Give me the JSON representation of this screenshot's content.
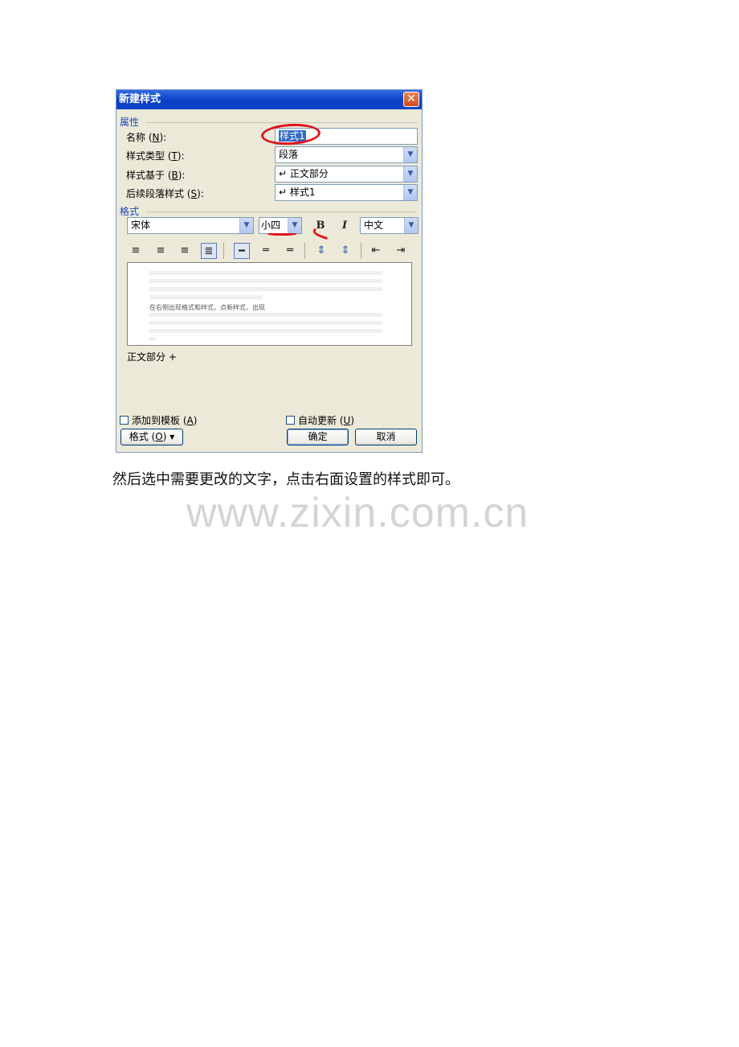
{
  "dialog": {
    "title": "新建样式",
    "close_glyph": "✕",
    "sections": {
      "properties": "属性",
      "format": "格式"
    },
    "fields": {
      "name": {
        "label": "名称",
        "key": "N",
        "value": "样式1"
      },
      "style_type": {
        "label": "样式类型",
        "key": "T",
        "value": "段落"
      },
      "based_on": {
        "label": "样式基于",
        "key": "B",
        "value": "↵ 正文部分"
      },
      "next_style": {
        "label": "后续段落样式",
        "key": "S",
        "value": "↵ 样式1"
      }
    },
    "format": {
      "font": "宋体",
      "size": "小四",
      "bold_glyph": "B",
      "italic_glyph": "I",
      "script": "中文"
    },
    "preview": {
      "sample": "在右侧出现格式和样式，点新样式，出现"
    },
    "description": "正文部分 +",
    "add_to_template": {
      "label": "添加到模板",
      "key": "A"
    },
    "auto_update": {
      "label": "自动更新",
      "key": "U"
    },
    "buttons": {
      "format": {
        "label": "格式",
        "key": "O"
      },
      "ok": "确定",
      "cancel": "取消"
    },
    "icons": [
      "align-left-icon",
      "align-center-icon",
      "align-right-icon",
      "justify-icon",
      "line-spacing-single-icon",
      "line-spacing-1-5-icon",
      "line-spacing-double-icon",
      "space-before-icon",
      "space-after-icon",
      "decrease-indent-icon",
      "increase-indent-icon"
    ],
    "colors": {
      "title_bar": "#0a3fc4",
      "section": "#1c48b8",
      "annotation": "#e0141a",
      "selection": "#316ac5"
    }
  },
  "caption": "然后选中需要更改的文字，点击右面设置的样式即可。",
  "watermark": "www.zixin.com.cn"
}
